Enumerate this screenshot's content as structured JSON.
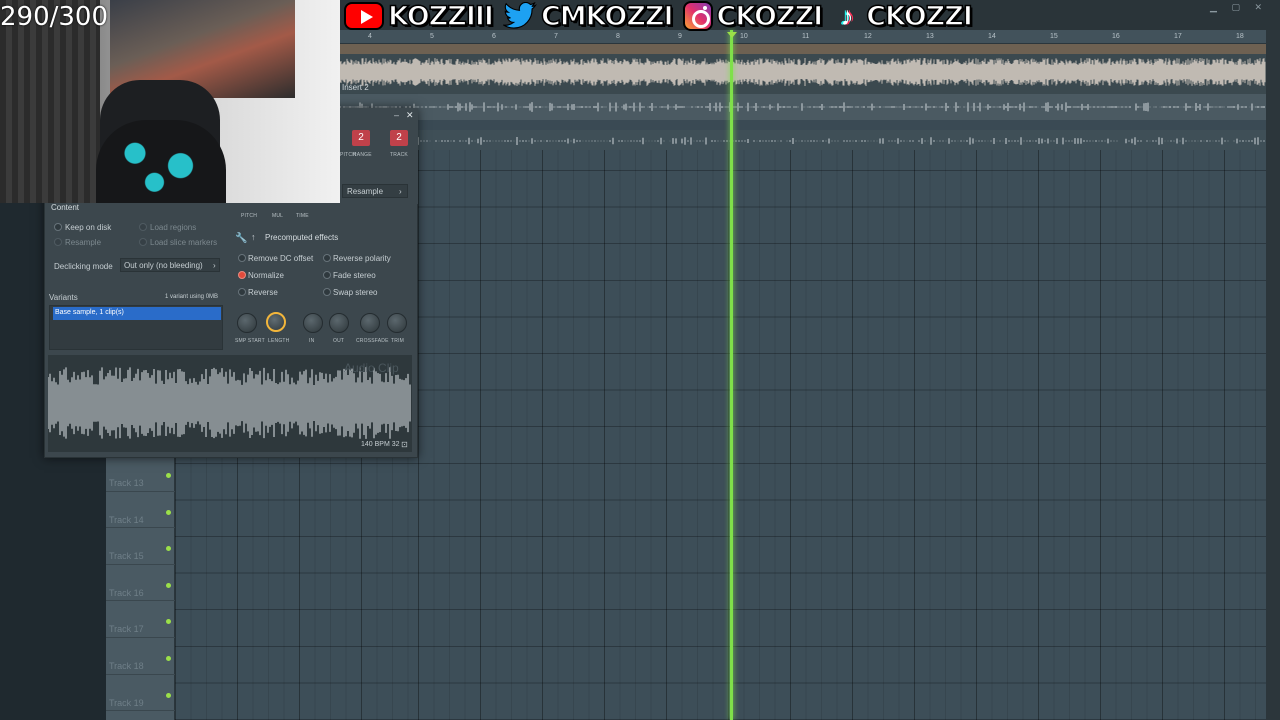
{
  "counter": "290/300",
  "social": {
    "youtube_icon": "youtube-icon",
    "youtube_handle": "KOZZIII",
    "twitter_icon": "twitter-icon",
    "twitter_handle": "CMKOZZI",
    "instagram_icon": "instagram-icon",
    "instagram_handle": "CKOZZI",
    "tiktok_icon": "tiktok-icon",
    "tiktok_handle": "CKOZZI",
    "youtube_color": "#ff0000",
    "twitter_color": "#1da1f2"
  },
  "ruler": {
    "ticks": [
      "4",
      "5",
      "6",
      "7",
      "8",
      "9",
      "10",
      "11",
      "12",
      "13",
      "14",
      "15",
      "16",
      "17",
      "18"
    ]
  },
  "playlist": {
    "insert_label": "Insert 2",
    "playhead_color": "#7fe04a",
    "tracks": [
      "Track 13",
      "Track 14",
      "Track 15",
      "Track 16",
      "Track 17",
      "Track 18",
      "Track 19"
    ]
  },
  "dialog": {
    "close_symbol": "✕",
    "minimize_symbol": "–",
    "top_knob_labels": [
      "PITCH",
      "RANGE",
      "TRACK"
    ],
    "pitch_range_value": "2",
    "track_value": "2",
    "small_labels": [
      "PITCH",
      "MUL",
      "TIME"
    ],
    "resample_label": "Resample",
    "content_title": "Content",
    "keep_on_disk": "Keep on disk",
    "resample_option": "Resample",
    "load_regions": "Load regions",
    "load_slice_markers": "Load slice markers",
    "declicking_label": "Declicking mode",
    "declicking_value": "Out only (no bleeding)",
    "variants_title": "Variants",
    "variants_info": "1 variant using 0MB",
    "variant_item": "Base sample, 1 clip(s)",
    "precomputed_title": "Precomputed effects",
    "effects": {
      "remove_dc": "Remove DC offset",
      "normalize": "Normalize",
      "reverse": "Reverse",
      "reverse_polarity": "Reverse polarity",
      "fade_stereo": "Fade stereo",
      "swap_stereo": "Swap stereo"
    },
    "knob_labels": [
      "SMP START",
      "LENGTH",
      "IN",
      "OUT",
      "CROSSFADE",
      "TRIM"
    ],
    "watermark": "Audio Clip",
    "bpm_info": "140 BPM 32",
    "accent_color": "#f3b63b",
    "selection_color": "#2a6cc9"
  }
}
